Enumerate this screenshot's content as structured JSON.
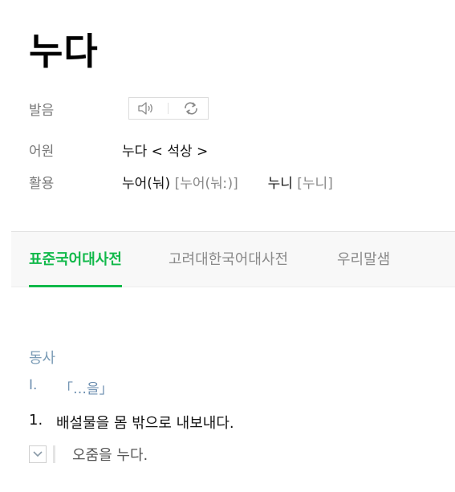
{
  "entry": {
    "headword": "누다"
  },
  "info": {
    "pronunciation": {
      "label": "발음",
      "play_icon": "speaker-icon",
      "repeat_icon": "repeat-icon"
    },
    "origin": {
      "label": "어원",
      "value": "누다 < 석상 >"
    },
    "conjugation": {
      "label": "활용",
      "forms": [
        {
          "form": "누어(눠)",
          "pron": "[누어(눠ː)]"
        },
        {
          "form": "누니",
          "pron": "[누니]"
        }
      ]
    }
  },
  "tabs": [
    {
      "label": "표준국어대사전",
      "active": true
    },
    {
      "label": "고려대한국어대사전",
      "active": false
    },
    {
      "label": "우리말샘",
      "active": false
    }
  ],
  "definition": {
    "part_of_speech": "동사",
    "pattern_number": "I.",
    "pattern": "「…을」",
    "senses": [
      {
        "number": "1.",
        "text": "배설물을 몸 밖으로 내보내다.",
        "example": "오줌을 누다."
      }
    ]
  },
  "colors": {
    "accent": "#11b94a",
    "pos_blue": "#7a9bb5"
  }
}
